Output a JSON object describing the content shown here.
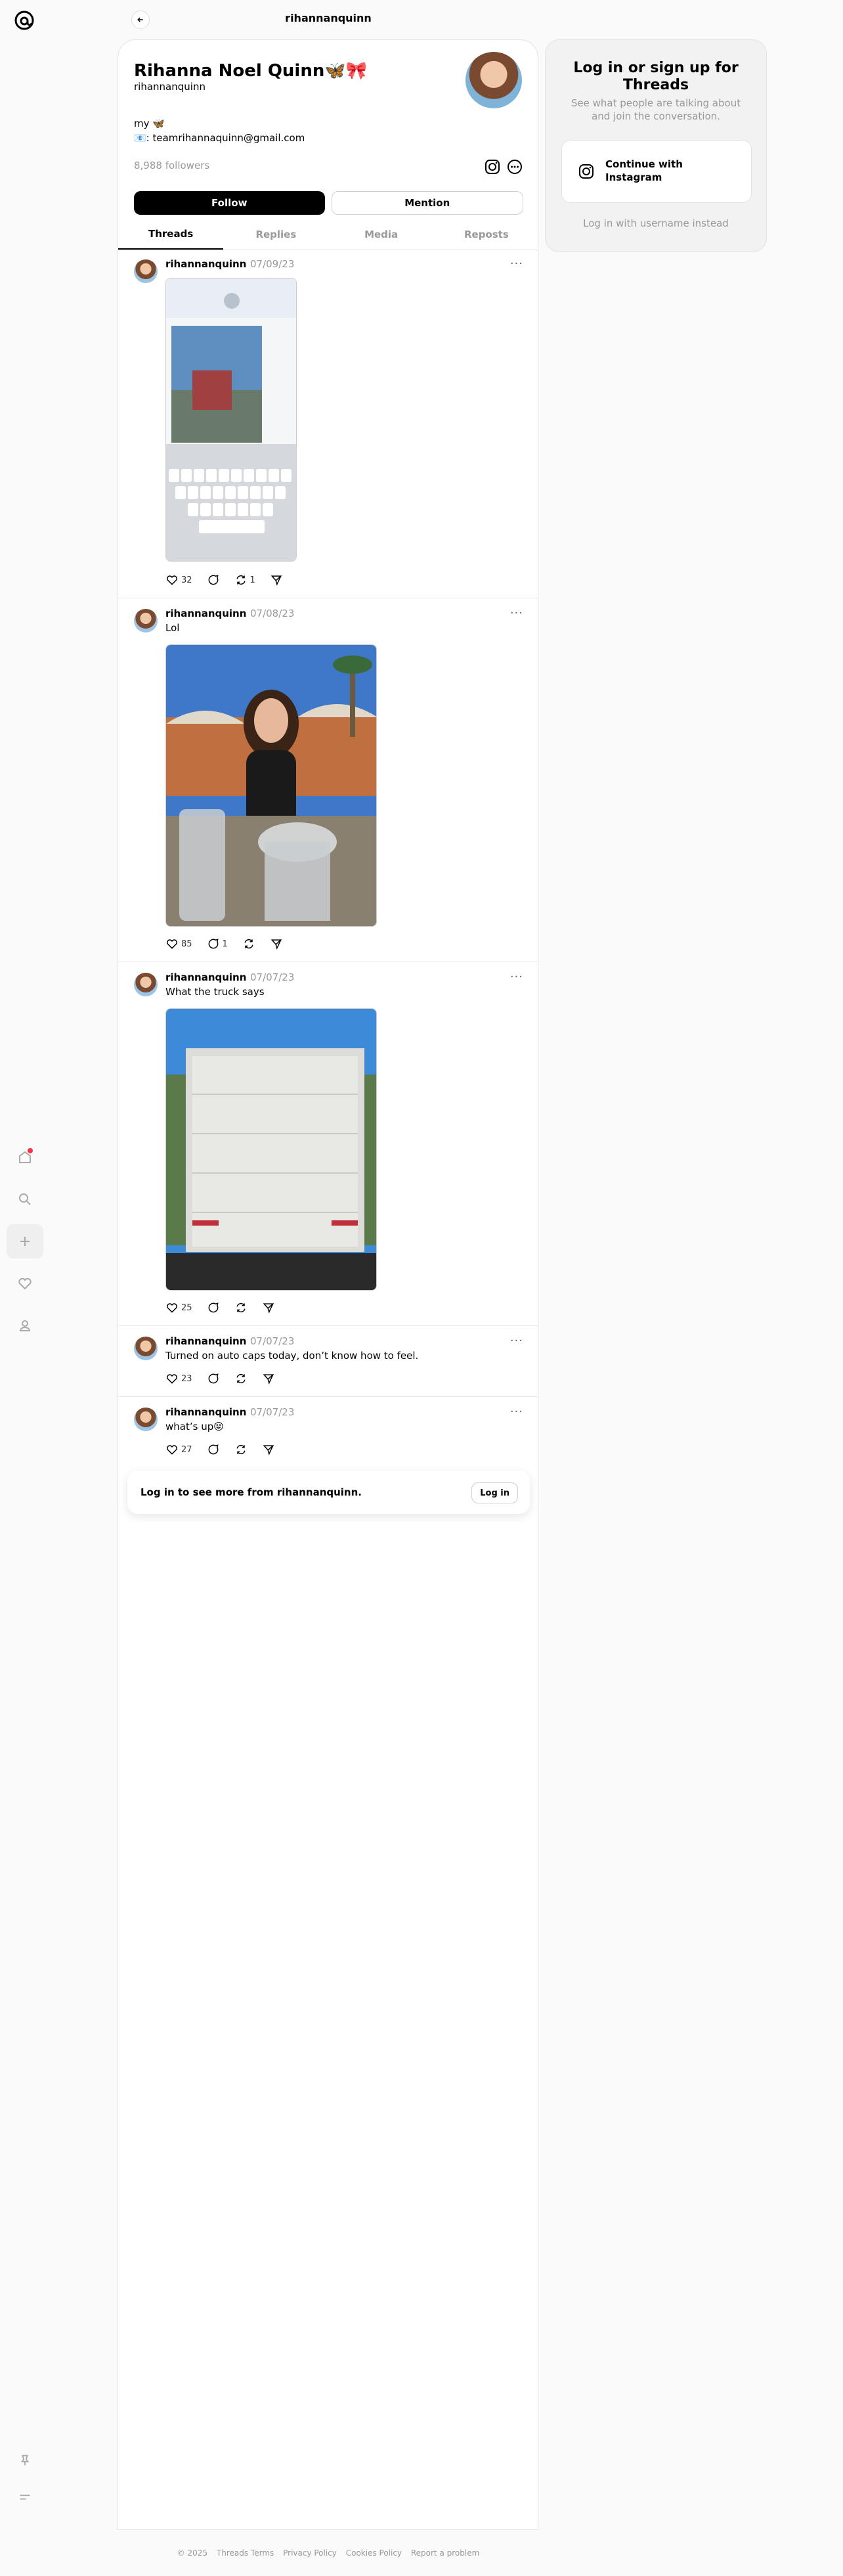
{
  "topbar": {
    "title": "rihannanquinn"
  },
  "profile": {
    "name": "Rihanna Noel Quinn🦋🎀",
    "username": "rihannanquinn",
    "bio_line1": "my 🦋",
    "bio_line2": "📧: teamrihannaquinn@gmail.com",
    "followers": "8,988 followers",
    "follow_label": "Follow",
    "mention_label": "Mention"
  },
  "tabs": [
    {
      "label": "Threads"
    },
    {
      "label": "Replies"
    },
    {
      "label": "Media"
    },
    {
      "label": "Reposts"
    }
  ],
  "posts": [
    {
      "author": "rihannanquinn",
      "date": "07/09/23",
      "text": "",
      "likes": "32",
      "replies": "",
      "reposts": "1"
    },
    {
      "author": "rihannanquinn",
      "date": "07/08/23",
      "text": "Lol",
      "likes": "85",
      "replies": "1",
      "reposts": ""
    },
    {
      "author": "rihannanquinn",
      "date": "07/07/23",
      "text": "What the truck says",
      "likes": "25",
      "replies": "",
      "reposts": ""
    },
    {
      "author": "rihannanquinn",
      "date": "07/07/23",
      "text": "Turned on auto caps today, don’t know how to feel.",
      "likes": "23",
      "replies": "",
      "reposts": ""
    },
    {
      "author": "rihannanquinn",
      "date": "07/07/23",
      "text": "what’s up😝",
      "likes": "27",
      "replies": "",
      "reposts": ""
    }
  ],
  "login_prompt": {
    "text": "Log in to see more from rihannanquinn.",
    "button": "Log in"
  },
  "sidebar": {
    "heading": "Log in or sign up for Threads",
    "sub": "See what people are talking about and join the conversation.",
    "instagram_button": "Continue with Instagram",
    "alt_login": "Log in with username instead"
  },
  "footer": [
    "© 2025",
    "Threads Terms",
    "Privacy Policy",
    "Cookies Policy",
    "Report a problem"
  ],
  "colors": {
    "notification_dot": "#ff3040",
    "follow_button": "#000000"
  }
}
